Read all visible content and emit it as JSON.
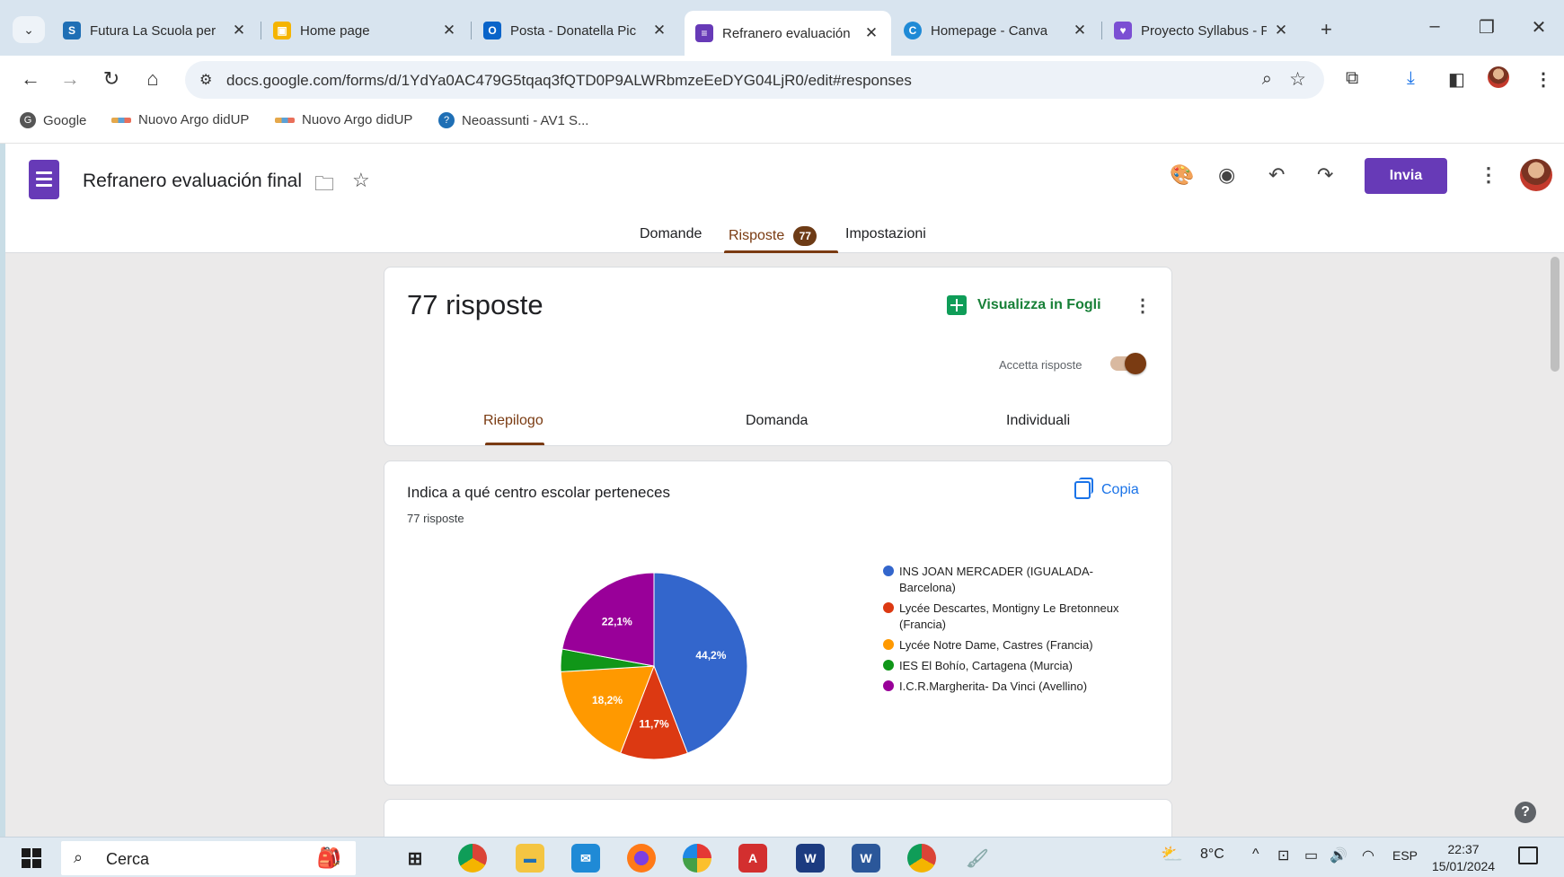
{
  "browser": {
    "tabs": [
      {
        "title": "Futura La Scuola per",
        "icon": "futura-icon",
        "color": "#1f6fb5"
      },
      {
        "title": "Home page",
        "icon": "classroom-icon",
        "color": "#f5b400"
      },
      {
        "title": "Posta - Donatella Pic",
        "icon": "outlook-icon",
        "color": "#0a64c9"
      },
      {
        "title": "Refranero evaluación",
        "icon": "forms-icon",
        "color": "#673ab7",
        "active": true
      },
      {
        "title": "Homepage - Canva",
        "icon": "canva-icon",
        "color": "#1f8ad6"
      },
      {
        "title": "Proyecto Syllabus - P",
        "icon": "syllabus-icon",
        "color": "#7b4fd3"
      }
    ],
    "url": "docs.google.com/forms/d/1YdYa0AC479G5tqaq3fQTD0P9ALWRbmzeEeDYG04LjR0/edit#responses",
    "bookmarks": [
      {
        "label": "Google",
        "icon": "google-icon"
      },
      {
        "label": "Nuovo Argo didUP",
        "icon": "argo-icon"
      },
      {
        "label": "Nuovo Argo didUP",
        "icon": "argo-icon"
      },
      {
        "label": "Neoassunti - AV1 S...",
        "icon": "neoassunti-icon"
      }
    ]
  },
  "form": {
    "title": "Refranero evaluación final",
    "send_label": "Invia",
    "tabs": [
      {
        "label": "Domande"
      },
      {
        "label": "Risposte",
        "badge": "77",
        "active": true
      },
      {
        "label": "Impostazioni"
      }
    ]
  },
  "summary": {
    "count_label": "77 risposte",
    "sheets_label": "Visualizza in Fogli",
    "accept_label": "Accetta risposte",
    "accepting": true,
    "sub_tabs": [
      {
        "label": "Riepilogo",
        "active": true
      },
      {
        "label": "Domanda"
      },
      {
        "label": "Individuali"
      }
    ]
  },
  "question": {
    "title": "Indica a qué centro escolar perteneces",
    "responses_label": "77 risposte",
    "copy_label": "Copia"
  },
  "chart_data": {
    "type": "pie",
    "title": "",
    "categories": [
      "INS JOAN MERCADER (IGUALADA-Barcelona)",
      "Lycée Descartes, Montigny Le Bretonneux (Francia)",
      "Lycée Notre Dame, Castres (Francia)",
      "IES El Bohío, Cartagena (Murcia)",
      "I.C.R.Margherita- Da Vinci (Avellino)"
    ],
    "values": [
      44.2,
      11.7,
      18.2,
      3.9,
      22.1
    ],
    "labels": [
      "44,2%",
      "11,7%",
      "18,2%",
      "",
      "22,1%"
    ],
    "colors": [
      "#3366cc",
      "#dc3912",
      "#ff9900",
      "#109618",
      "#990099"
    ],
    "legend_position": "right"
  },
  "taskbar": {
    "search_label": "Cerca",
    "weather": "8°C",
    "lang": "ESP",
    "time": "22:37",
    "date": "15/01/2024"
  }
}
